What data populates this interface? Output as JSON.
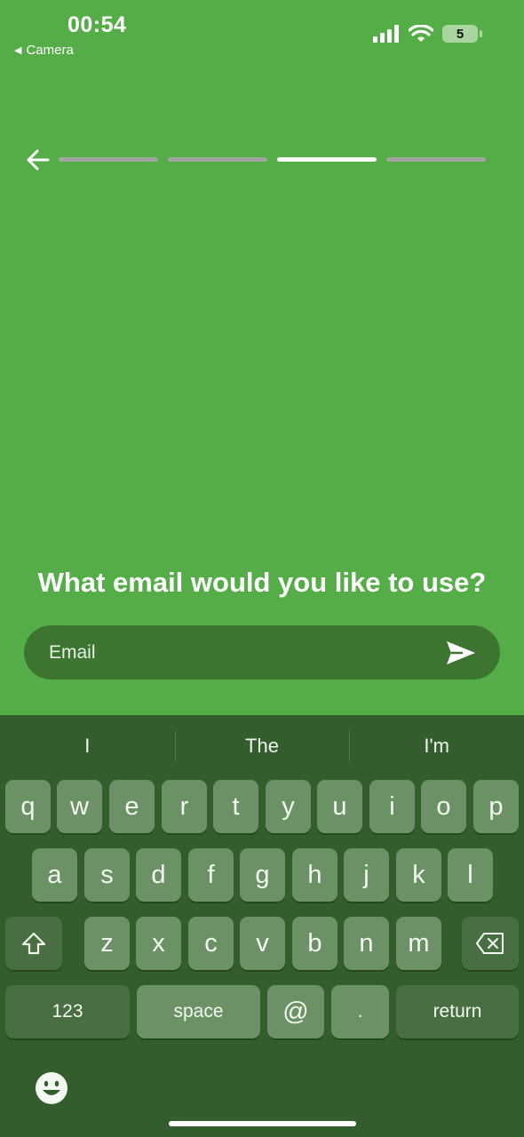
{
  "status_bar": {
    "time": "00:54",
    "back_label": "Camera",
    "battery": "5"
  },
  "progress": {
    "steps": 4,
    "current_step": 3
  },
  "question": "What email would you like to use?",
  "email_input": {
    "placeholder": "Email",
    "value": ""
  },
  "keyboard": {
    "suggestions": [
      "I",
      "The",
      "I'm"
    ],
    "row1": [
      "q",
      "w",
      "e",
      "r",
      "t",
      "y",
      "u",
      "i",
      "o",
      "p"
    ],
    "row2": [
      "a",
      "s",
      "d",
      "f",
      "g",
      "h",
      "j",
      "k",
      "l"
    ],
    "row3": [
      "z",
      "x",
      "c",
      "v",
      "b",
      "n",
      "m"
    ],
    "bottom": {
      "numbers": "123",
      "space": "space",
      "at": "@",
      "dot": ".",
      "return": "return"
    }
  },
  "colors": {
    "background": "#55ad48",
    "field": "#3b7530",
    "keyboard": "#345d2e",
    "key": "#6c9166"
  }
}
